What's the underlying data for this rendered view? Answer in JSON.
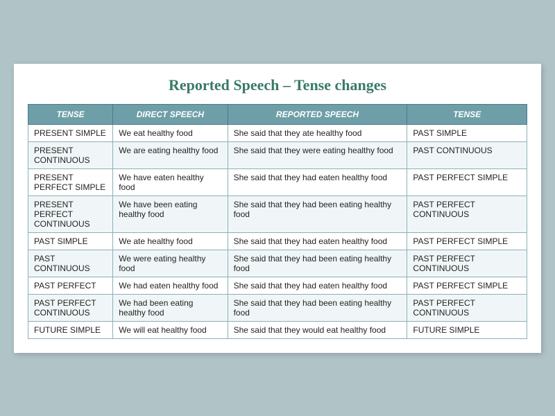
{
  "title": "Reported Speech – Tense changes",
  "headers": {
    "tense": "TENSE",
    "direct_speech": "DIRECT SPEECH",
    "reported_speech": "REPORTED SPEECH",
    "tense2": "TENSE"
  },
  "rows": [
    {
      "tense": "PRESENT SIMPLE",
      "direct": "We eat healthy food",
      "reported": "She said that they ate healthy food",
      "tense2": "PAST SIMPLE"
    },
    {
      "tense": "PRESENT CONTINUOUS",
      "direct": "We are eating healthy food",
      "reported": "She said that they were eating healthy food",
      "tense2": "PAST CONTINUOUS"
    },
    {
      "tense": "PRESENT PERFECT SIMPLE",
      "direct": "We have eaten healthy food",
      "reported": "She said that they had eaten healthy food",
      "tense2": "PAST PERFECT SIMPLE"
    },
    {
      "tense": "PRESENT PERFECT CONTINUOUS",
      "direct": "We have been eating healthy food",
      "reported": "She said that they had been eating healthy food",
      "tense2": "PAST PERFECT CONTINUOUS"
    },
    {
      "tense": "PAST SIMPLE",
      "direct": "We ate healthy food",
      "reported": "She said that they had eaten healthy food",
      "tense2": "PAST PERFECT SIMPLE"
    },
    {
      "tense": "PAST CONTINUOUS",
      "direct": "We were eating healthy food",
      "reported": "She said that they had been eating healthy food",
      "tense2": "PAST PERFECT CONTINUOUS"
    },
    {
      "tense": "PAST PERFECT",
      "direct": "We had eaten healthy food",
      "reported": "She said that they had eaten healthy food",
      "tense2": "PAST PERFECT SIMPLE"
    },
    {
      "tense": "PAST PERFECT CONTINUOUS",
      "direct": "We had been eating healthy food",
      "reported": "She said that they had been eating  healthy food",
      "tense2": "PAST PERFECT CONTINUOUS"
    },
    {
      "tense": "FUTURE SIMPLE",
      "direct": "We will eat healthy food",
      "reported": "She said that they would eat healthy food",
      "tense2": "FUTURE SIMPLE"
    }
  ]
}
